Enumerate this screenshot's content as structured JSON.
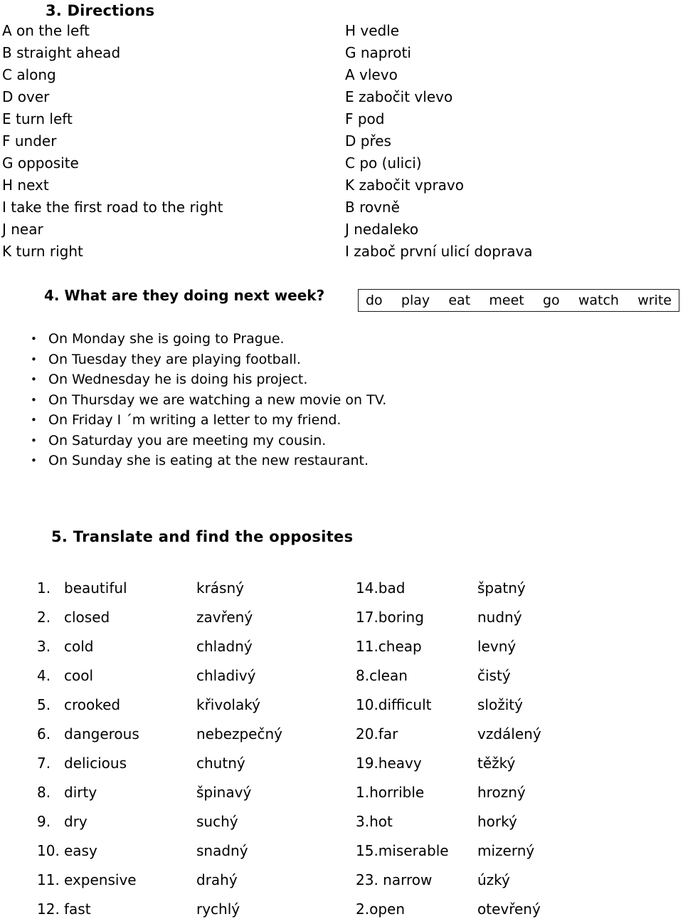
{
  "section3": {
    "heading": "3.  Directions",
    "rows": [
      {
        "en": "A on the left",
        "cs": "H vedle"
      },
      {
        "en": "B straight ahead",
        "cs": "G naproti"
      },
      {
        "en": "C along",
        "cs": "A vlevo"
      },
      {
        "en": "D over",
        "cs": "E zabočit vlevo"
      },
      {
        "en": "E turn left",
        "cs": "F pod"
      },
      {
        "en": "F under",
        "cs": "D přes"
      },
      {
        "en": "G opposite",
        "cs": "C po (ulici)"
      },
      {
        "en": "H next",
        "cs": "K zabočit vpravo"
      },
      {
        "en": "I take the first road to the right",
        "cs": "B rovně"
      },
      {
        "en": "J near",
        "cs": "J nedaleko"
      },
      {
        "en": "K turn right",
        "cs": "I zaboč první ulicí doprava"
      }
    ]
  },
  "section4": {
    "heading": "4.  What are they doing next week?",
    "wordbank": [
      "do",
      "play",
      "eat",
      "meet",
      "go",
      "watch",
      "write"
    ],
    "sentences": [
      "On Monday she is going to Prague.",
      "On Tuesday they are playing football.",
      "On Wednesday he is doing his project.",
      "On Thursday we are watching a new movie on TV.",
      "On Friday I ´m writing a letter to my friend.",
      "On Saturday you are meeting my cousin.",
      "On Sunday she is eating at the new restaurant."
    ],
    "bullet": "•"
  },
  "section5": {
    "heading": "5. Translate and find the opposites",
    "rows": [
      {
        "num_l": "1.",
        "en_l": "beautiful",
        "cs_l": "krásný",
        "num_r": "14.bad",
        "cs_r": "špatný"
      },
      {
        "num_l": "2.",
        "en_l": "closed",
        "cs_l": "zavřený",
        "num_r": "17.boring",
        "cs_r": "nudný"
      },
      {
        "num_l": "3.",
        "en_l": "cold",
        "cs_l": "chladný",
        "num_r": "11.cheap",
        "cs_r": "levný"
      },
      {
        "num_l": "4.",
        "en_l": "cool",
        "cs_l": "chladivý",
        "num_r": "8.clean",
        "cs_r": "čistý"
      },
      {
        "num_l": "5.",
        "en_l": "crooked",
        "cs_l": "křivolaký",
        "num_r": "10.difficult",
        "cs_r": "složitý"
      },
      {
        "num_l": "6.",
        "en_l": "dangerous",
        "cs_l": "nebezpečný",
        "num_r": "20.far",
        "cs_r": "vzdálený"
      },
      {
        "num_l": "7.",
        "en_l": "delicious",
        "cs_l": "chutný",
        "num_r": "19.heavy",
        "cs_r": "těžký"
      },
      {
        "num_l": "8.",
        "en_l": "dirty",
        "cs_l": "špinavý",
        "num_r": "1.horrible",
        "cs_r": "hrozný"
      },
      {
        "num_l": "9.",
        "en_l": "dry",
        "cs_l": "suchý",
        "num_r": "3.hot",
        "cs_r": "horký"
      },
      {
        "num_l": "10.",
        "en_l": "easy",
        "cs_l": "snadný",
        "num_r": "15.miserable",
        "cs_r": "mizerný"
      },
      {
        "num_l": "11.",
        "en_l": "expensive",
        "cs_l": "drahý",
        "num_r": "23. narrow",
        "cs_r": "úzký"
      },
      {
        "num_l": "12.",
        "en_l": "fast",
        "cs_l": "rychlý",
        "num_r": "2.open",
        "cs_r": "otevřený"
      }
    ]
  }
}
